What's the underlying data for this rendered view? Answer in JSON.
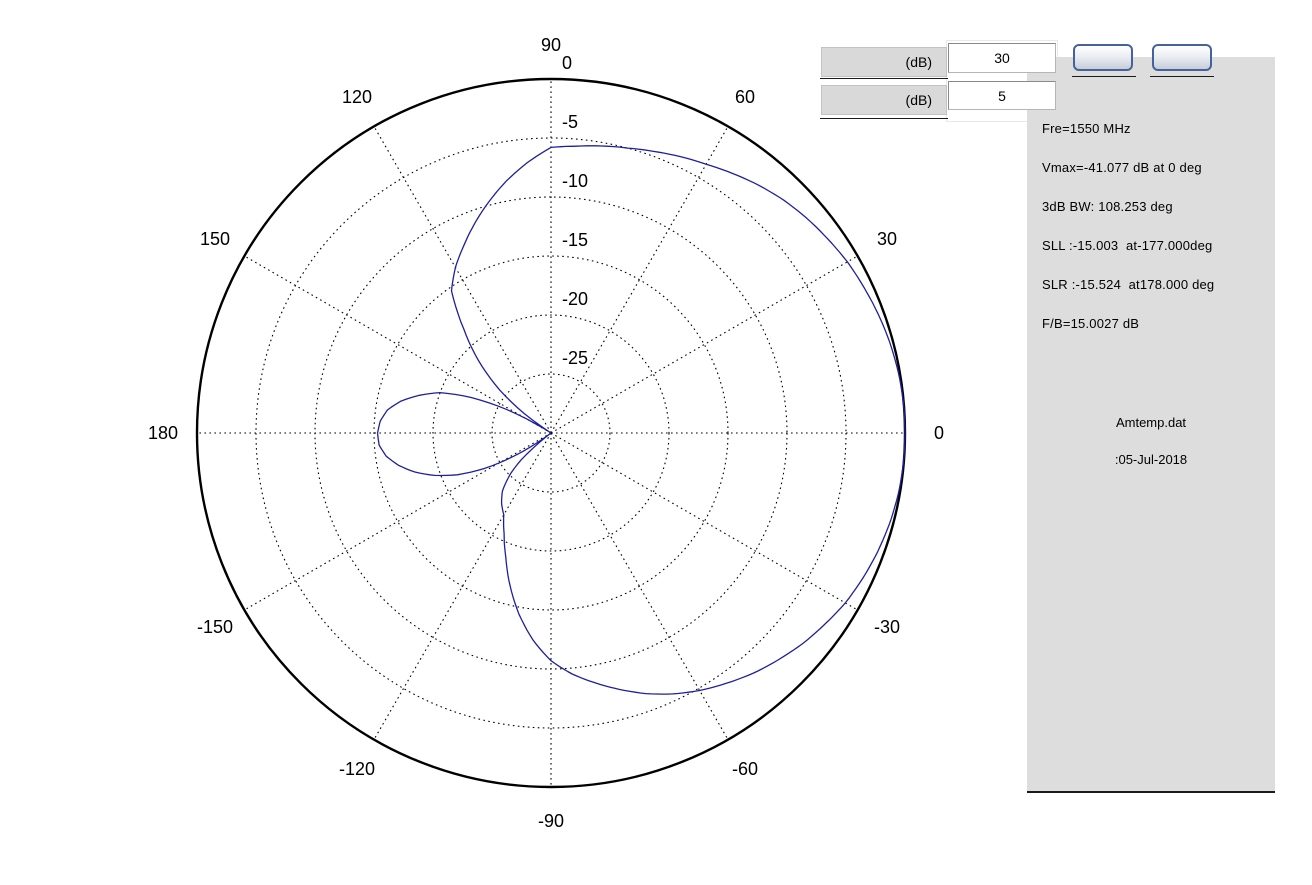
{
  "controls": {
    "range_field": {
      "label": "(dB)",
      "value": "30"
    },
    "step_field": {
      "label": "(dB)",
      "value": "5"
    },
    "buttons": [
      {
        "label": ""
      },
      {
        "label": ""
      }
    ]
  },
  "info_panel": {
    "background": "#dddddd",
    "lines": [
      "Fre=1550 MHz",
      "Vmax=-41.077 dB at 0 deg",
      "3dB BW: 108.253 deg",
      "SLL :-15.003  at-177.000deg",
      "SLR :-15.524  at178.000 deg",
      "F/B=15.0027 dB"
    ],
    "file_name": "Amtemp.dat",
    "date_line": ":05-Jul-2018"
  },
  "chart_data": {
    "type": "polar-line",
    "title": "",
    "angle_unit": "deg",
    "radial_unit": "dB",
    "r_axis": {
      "min": -30,
      "max": 0,
      "tick_step": 5,
      "tick_labels": [
        "0",
        "-5",
        "-10",
        "-15",
        "-20",
        "-25"
      ]
    },
    "angle_ticks": [
      90,
      120,
      150,
      180,
      -150,
      -120,
      -90,
      -60,
      -30,
      0,
      30,
      60
    ],
    "grid": {
      "style": "dotted",
      "color": "#000000",
      "outer_circle_color": "#000000"
    },
    "legend": "none",
    "series": [
      {
        "name": "radiation-pattern",
        "color": "#1f1f9e",
        "points": [
          [
            -180,
            -15.3
          ],
          [
            -176,
            -15.4
          ],
          [
            -172,
            -15.9
          ],
          [
            -168,
            -16.8
          ],
          [
            -164,
            -18.0
          ],
          [
            -160,
            -19.5
          ],
          [
            -156,
            -21.3
          ],
          [
            -152,
            -23.6
          ],
          [
            -148,
            -26.3
          ],
          [
            -145,
            -28.6
          ],
          [
            -143,
            -30
          ],
          [
            -141,
            -28.8
          ],
          [
            -138,
            -26.6
          ],
          [
            -135,
            -25.2
          ],
          [
            -130,
            -23.6
          ],
          [
            -125,
            -22.7
          ],
          [
            -120,
            -22.0
          ],
          [
            -115,
            -20.6
          ],
          [
            -110,
            -18.8
          ],
          [
            -105,
            -16.6
          ],
          [
            -100,
            -14.4
          ],
          [
            -95,
            -12.4
          ],
          [
            -90,
            -10.7
          ],
          [
            -85,
            -9.5
          ],
          [
            -80,
            -8.5
          ],
          [
            -75,
            -7.5
          ],
          [
            -70,
            -6.5
          ],
          [
            -65,
            -5.6
          ],
          [
            -60,
            -4.8
          ],
          [
            -55,
            -4.1
          ],
          [
            -50,
            -3.4
          ],
          [
            -45,
            -2.8
          ],
          [
            -40,
            -2.2
          ],
          [
            -35,
            -1.7
          ],
          [
            -30,
            -1.2
          ],
          [
            -25,
            -0.85
          ],
          [
            -20,
            -0.55
          ],
          [
            -15,
            -0.3
          ],
          [
            -10,
            -0.12
          ],
          [
            -5,
            -0.03
          ],
          [
            0,
            0
          ],
          [
            5,
            -0.03
          ],
          [
            10,
            -0.12
          ],
          [
            15,
            -0.28
          ],
          [
            20,
            -0.5
          ],
          [
            25,
            -0.75
          ],
          [
            30,
            -1.0
          ],
          [
            35,
            -1.35
          ],
          [
            40,
            -1.7
          ],
          [
            45,
            -2.1
          ],
          [
            50,
            -2.6
          ],
          [
            55,
            -3.15
          ],
          [
            60,
            -3.7
          ],
          [
            65,
            -4.15
          ],
          [
            70,
            -4.6
          ],
          [
            75,
            -5.0
          ],
          [
            80,
            -5.3
          ],
          [
            85,
            -5.6
          ],
          [
            90,
            -5.8
          ],
          [
            95,
            -7.0
          ],
          [
            100,
            -8.3
          ],
          [
            105,
            -9.7
          ],
          [
            110,
            -11.1
          ],
          [
            115,
            -12.5
          ],
          [
            120,
            -13.8
          ],
          [
            125,
            -15.3
          ],
          [
            130,
            -18.5
          ],
          [
            135,
            -21.3
          ],
          [
            140,
            -24.3
          ],
          [
            144,
            -27.2
          ],
          [
            147,
            -30
          ],
          [
            149,
            -28.6
          ],
          [
            152,
            -25.8
          ],
          [
            156,
            -22.6
          ],
          [
            160,
            -20.0
          ],
          [
            164,
            -18.4
          ],
          [
            168,
            -17.0
          ],
          [
            172,
            -16.0
          ],
          [
            176,
            -15.5
          ],
          [
            180,
            -15.3
          ]
        ]
      }
    ]
  }
}
